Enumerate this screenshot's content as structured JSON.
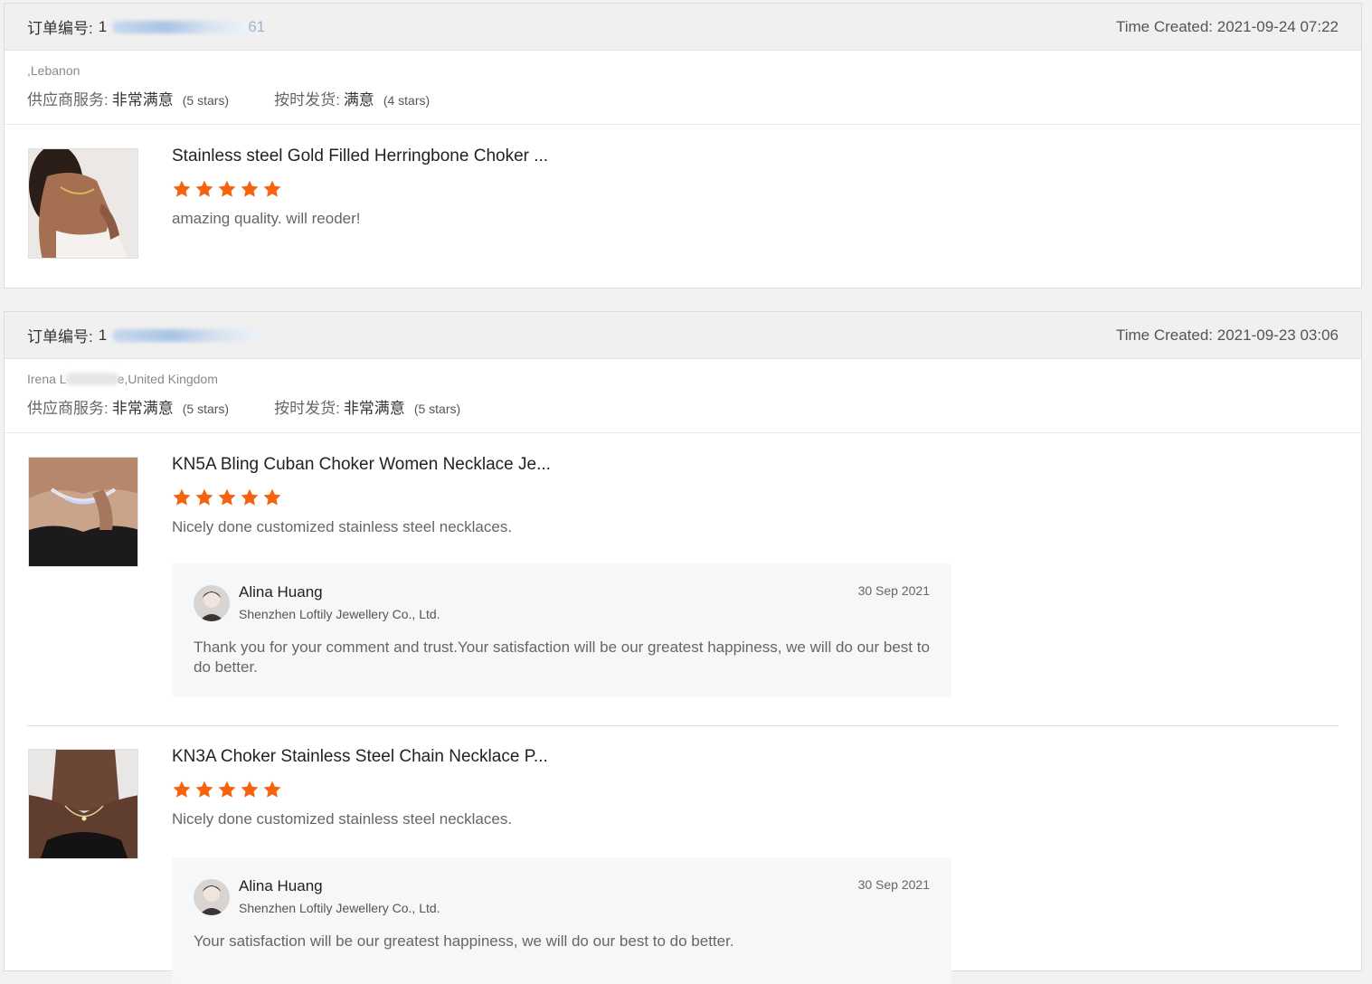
{
  "orders": [
    {
      "order_label": "订单编号:",
      "order_no_visible_start": "1",
      "order_no_visible_end": "61",
      "time_label": "Time Created:",
      "time_value": "2021-09-24 07:22",
      "buyer_name_start": "",
      "buyer_country": ",Lebanon",
      "service_label": "供应商服务:",
      "service_value": "非常满意",
      "service_stars": "(5 stars)",
      "shipping_label": "按时发货:",
      "shipping_value": "满意",
      "shipping_stars": "(4 stars)",
      "products": [
        {
          "title": "Stainless steel Gold Filled Herringbone Choker ...",
          "rating": 5,
          "review": "amazing quality. will reoder!"
        }
      ]
    },
    {
      "order_label": "订单编号:",
      "order_no_visible_start": "1",
      "order_no_visible_end": "",
      "time_label": "Time Created:",
      "time_value": "2021-09-23 03:06",
      "buyer_name_start": "Irena L",
      "buyer_country": "e,United Kingdom",
      "service_label": "供应商服务:",
      "service_value": "非常满意",
      "service_stars": "(5 stars)",
      "shipping_label": "按时发货:",
      "shipping_value": "非常满意",
      "shipping_stars": "(5 stars)",
      "products": [
        {
          "title": "KN5A Bling Cuban Choker Women Necklace Je...",
          "rating": 5,
          "review": "Nicely done customized stainless steel necklaces.",
          "reply": {
            "name": "Alina Huang",
            "company": "Shenzhen Loftily Jewellery Co., Ltd.",
            "date": "30 Sep 2021",
            "text": "Thank you for your comment and trust.Your satisfaction will be our greatest happiness, we will do our best to do better."
          }
        },
        {
          "title": "KN3A Choker Stainless Steel Chain Necklace P...",
          "rating": 5,
          "review": "Nicely done customized stainless steel necklaces.",
          "reply": {
            "name": "Alina Huang",
            "company": "Shenzhen Loftily Jewellery Co., Ltd.",
            "date": "30 Sep 2021",
            "text": "Your satisfaction will be our greatest happiness, we will do our best to do better."
          }
        }
      ]
    }
  ],
  "colors": {
    "star": "#f5630f",
    "header_bg": "#f0f0f0",
    "reply_bg": "#f6f7f9"
  },
  "icons": {
    "rating_star": "star-icon",
    "avatar": "avatar"
  }
}
